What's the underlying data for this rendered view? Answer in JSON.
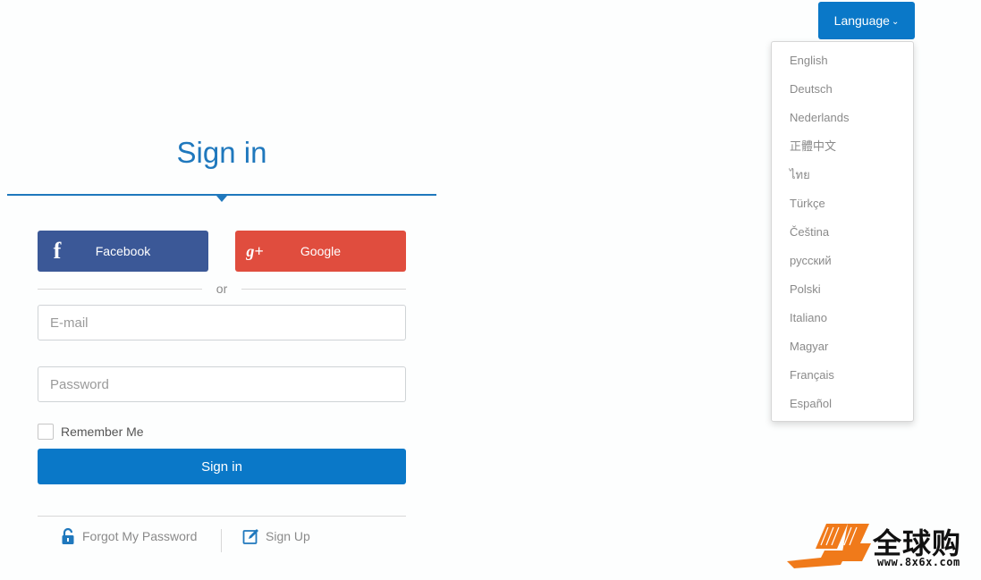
{
  "language": {
    "button_label": "Language",
    "options": [
      "English",
      "Deutsch",
      "Nederlands",
      "正體中文",
      "ไทย",
      "Türkçe",
      "Čeština",
      "русский",
      "Polski",
      "Italiano",
      "Magyar",
      "Français",
      "Español"
    ]
  },
  "signin": {
    "title": "Sign in",
    "facebook_label": "Facebook",
    "google_label": "Google",
    "or_text": "or",
    "email_placeholder": "E-mail",
    "password_placeholder": "Password",
    "remember_label": "Remember Me",
    "submit_label": "Sign in",
    "forgot_label": "Forgot My Password",
    "signup_label": "Sign Up"
  },
  "icons": {
    "facebook": "facebook-icon",
    "google": "google-plus-icon",
    "forgot": "padlock-icon",
    "signup": "edit-icon",
    "caret": "chevron-down-icon"
  },
  "colors": {
    "primary": "#0a78c8",
    "title_blue": "#1f78bd",
    "facebook": "#3b5897",
    "google": "#e04d3e"
  },
  "watermark": {
    "brand": "全球购",
    "url": "www.8x6x.com"
  }
}
